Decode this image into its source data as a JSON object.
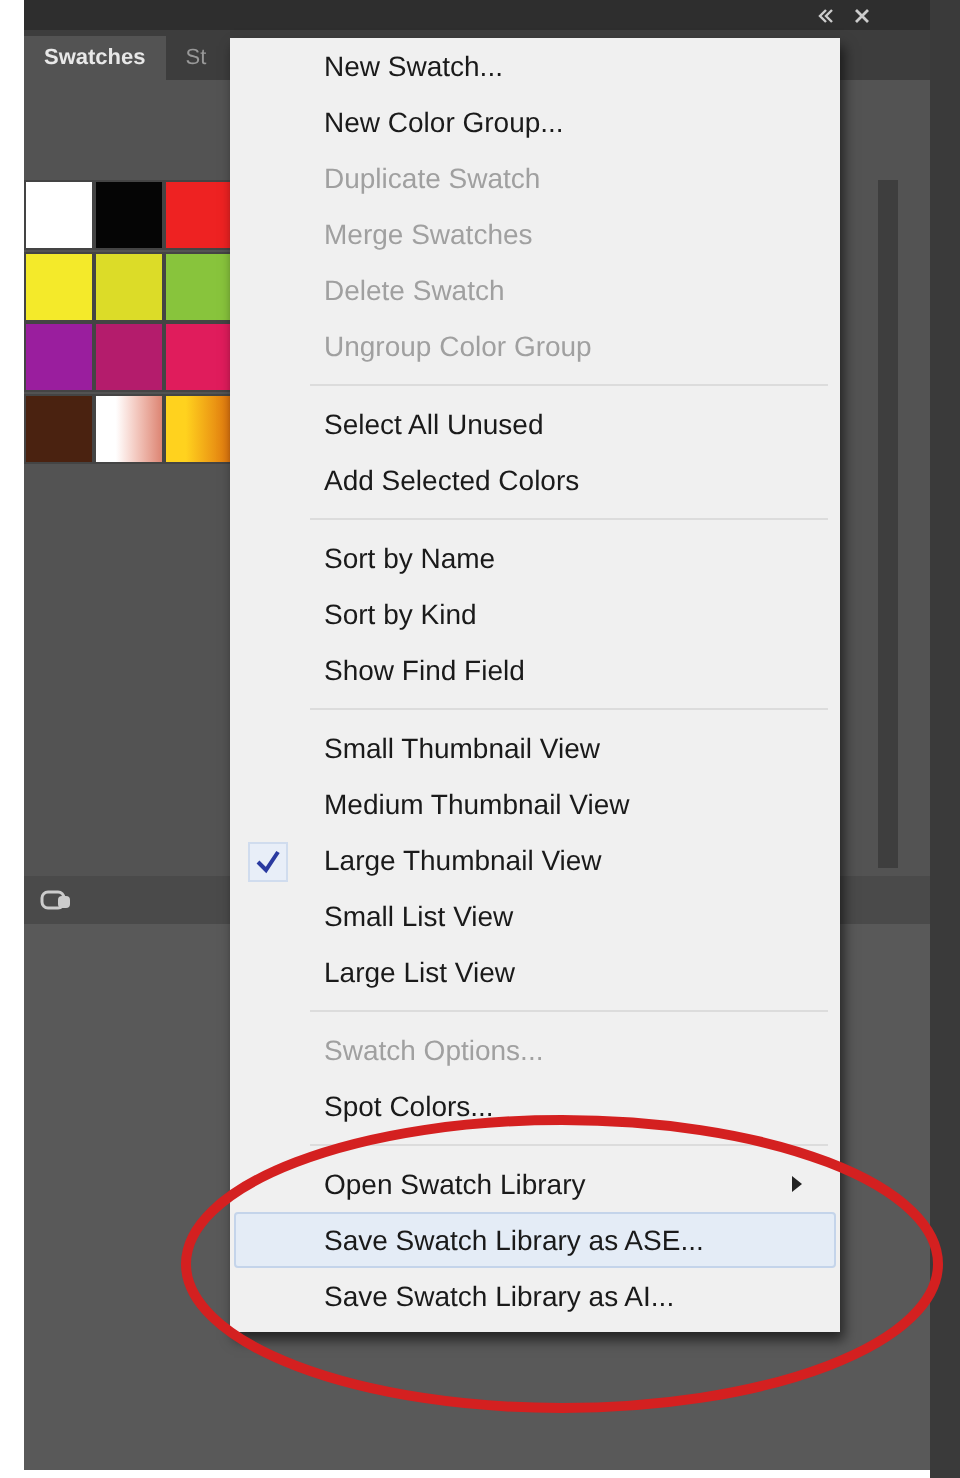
{
  "tabs": [
    {
      "label": "Swatches",
      "selected": true
    },
    {
      "label": "St",
      "selected": false
    }
  ],
  "swatches": [
    {
      "kind": "solid",
      "color": "#ffffff"
    },
    {
      "kind": "solid",
      "color": "#050505"
    },
    {
      "kind": "solid",
      "color": "#ee2222"
    },
    {
      "kind": "solid",
      "color": "#f4ea2a"
    },
    {
      "kind": "solid",
      "color": "#dcdc28"
    },
    {
      "kind": "solid",
      "color": "#88c43c"
    },
    {
      "kind": "solid",
      "color": "#9a1e9e"
    },
    {
      "kind": "solid",
      "color": "#b41c6c"
    },
    {
      "kind": "solid",
      "color": "#e01c5c"
    },
    {
      "kind": "solid",
      "color": "#4a2210"
    },
    {
      "kind": "gradient",
      "color": "#ffffff"
    },
    {
      "kind": "gradient",
      "color": "#ffd21e"
    }
  ],
  "menu": {
    "sections": [
      [
        {
          "label": "New Swatch...",
          "disabled": false,
          "checked": false,
          "selected": false,
          "submenu": false
        },
        {
          "label": "New Color Group...",
          "disabled": false,
          "checked": false,
          "selected": false,
          "submenu": false
        },
        {
          "label": "Duplicate Swatch",
          "disabled": true,
          "checked": false,
          "selected": false,
          "submenu": false
        },
        {
          "label": "Merge Swatches",
          "disabled": true,
          "checked": false,
          "selected": false,
          "submenu": false
        },
        {
          "label": "Delete Swatch",
          "disabled": true,
          "checked": false,
          "selected": false,
          "submenu": false
        },
        {
          "label": "Ungroup Color Group",
          "disabled": true,
          "checked": false,
          "selected": false,
          "submenu": false
        }
      ],
      [
        {
          "label": "Select All Unused",
          "disabled": false,
          "checked": false,
          "selected": false,
          "submenu": false
        },
        {
          "label": "Add Selected Colors",
          "disabled": false,
          "checked": false,
          "selected": false,
          "submenu": false
        }
      ],
      [
        {
          "label": "Sort by Name",
          "disabled": false,
          "checked": false,
          "selected": false,
          "submenu": false
        },
        {
          "label": "Sort by Kind",
          "disabled": false,
          "checked": false,
          "selected": false,
          "submenu": false
        },
        {
          "label": "Show Find Field",
          "disabled": false,
          "checked": false,
          "selected": false,
          "submenu": false
        }
      ],
      [
        {
          "label": "Small Thumbnail View",
          "disabled": false,
          "checked": false,
          "selected": false,
          "submenu": false
        },
        {
          "label": "Medium Thumbnail View",
          "disabled": false,
          "checked": false,
          "selected": false,
          "submenu": false
        },
        {
          "label": "Large Thumbnail View",
          "disabled": false,
          "checked": true,
          "selected": false,
          "submenu": false
        },
        {
          "label": "Small List View",
          "disabled": false,
          "checked": false,
          "selected": false,
          "submenu": false
        },
        {
          "label": "Large List View",
          "disabled": false,
          "checked": false,
          "selected": false,
          "submenu": false
        }
      ],
      [
        {
          "label": "Swatch Options...",
          "disabled": true,
          "checked": false,
          "selected": false,
          "submenu": false
        },
        {
          "label": "Spot Colors...",
          "disabled": false,
          "checked": false,
          "selected": false,
          "submenu": false
        }
      ],
      [
        {
          "label": "Open Swatch Library",
          "disabled": false,
          "checked": false,
          "selected": false,
          "submenu": true
        },
        {
          "label": "Save Swatch Library as ASE...",
          "disabled": false,
          "checked": false,
          "selected": true,
          "submenu": false
        },
        {
          "label": "Save Swatch Library as AI...",
          "disabled": false,
          "checked": false,
          "selected": false,
          "submenu": false
        }
      ]
    ]
  }
}
